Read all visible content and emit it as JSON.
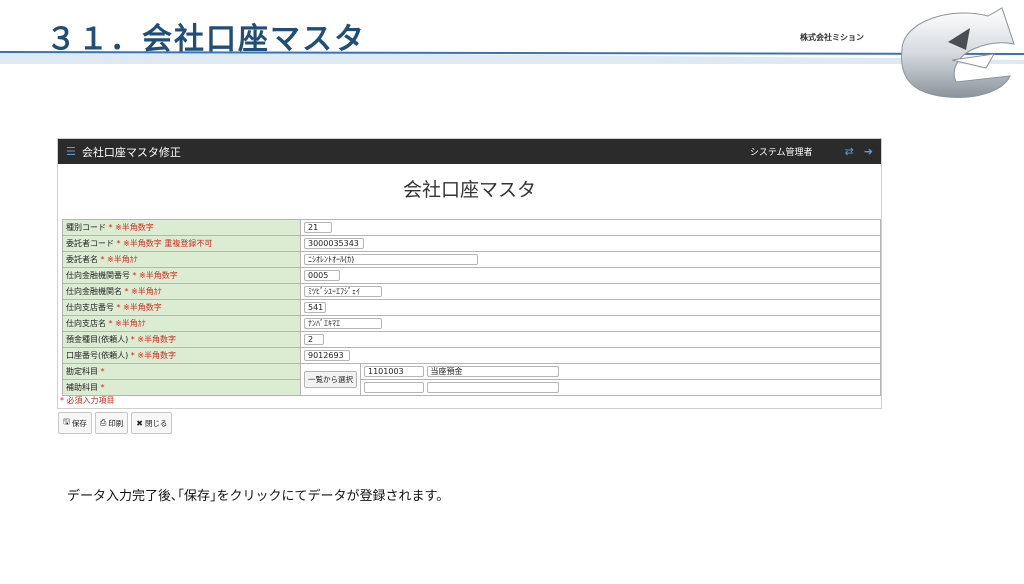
{
  "slide": {
    "title": "３１．会社口座マスタ",
    "company": "株式会社ミション",
    "caption": "データ入力完了後､｢保存｣をクリックにてデータが登録されます。"
  },
  "colors": {
    "title": "#1f4e79",
    "label_bg": "#dcecd3",
    "required": "#d9261c",
    "topbar": "#2b2b2b",
    "icon_accent": "#5b9bd5"
  },
  "app": {
    "window_title": "会社口座マスタ修正",
    "user": "システム管理者",
    "icons": [
      "menu-icon",
      "swap-icon",
      "logout-icon"
    ],
    "form_title": "会社口座マスタ",
    "required_mark": "*",
    "fields": [
      {
        "label": "種別コード",
        "rule": "※半角数字",
        "value": "21"
      },
      {
        "label": "委託者コード",
        "rule": "※半角数字 重複登録不可",
        "value": "3000035343"
      },
      {
        "label": "委託者名",
        "rule": "※半角ｶﾅ",
        "value": "ﾆｼｵﾚﾝﾄｵｰﾙ(ｶ)"
      },
      {
        "label": "仕向金融機関番号",
        "rule": "※半角数字",
        "value": "0005"
      },
      {
        "label": "仕向金融機関名",
        "rule": "※半角ｶﾅ",
        "value": "ﾐﾂﾋﾞｼﾕｰｴﾌｼﾞｪｲ"
      },
      {
        "label": "仕向支店番号",
        "rule": "※半角数字",
        "value": "541"
      },
      {
        "label": "仕向支店名",
        "rule": "※半角ｶﾅ",
        "value": "ﾅﾝﾊﾞｴｷﾏｴ"
      },
      {
        "label": "預金種目(依頼人)",
        "rule": "※半角数字",
        "value": "2"
      },
      {
        "label": "口座番号(依頼人)",
        "rule": "※半角数字",
        "value": "9012693"
      }
    ],
    "account": {
      "label": "勘定科目",
      "code": "1101003",
      "name": "当座預金",
      "select_button": "一覧から選択"
    },
    "sub_account": {
      "label": "補助科目",
      "code": "",
      "name": ""
    },
    "required_note": "* 必須入力項目",
    "buttons": {
      "save": "保存",
      "print": "印刷",
      "close": "閉じる"
    }
  }
}
